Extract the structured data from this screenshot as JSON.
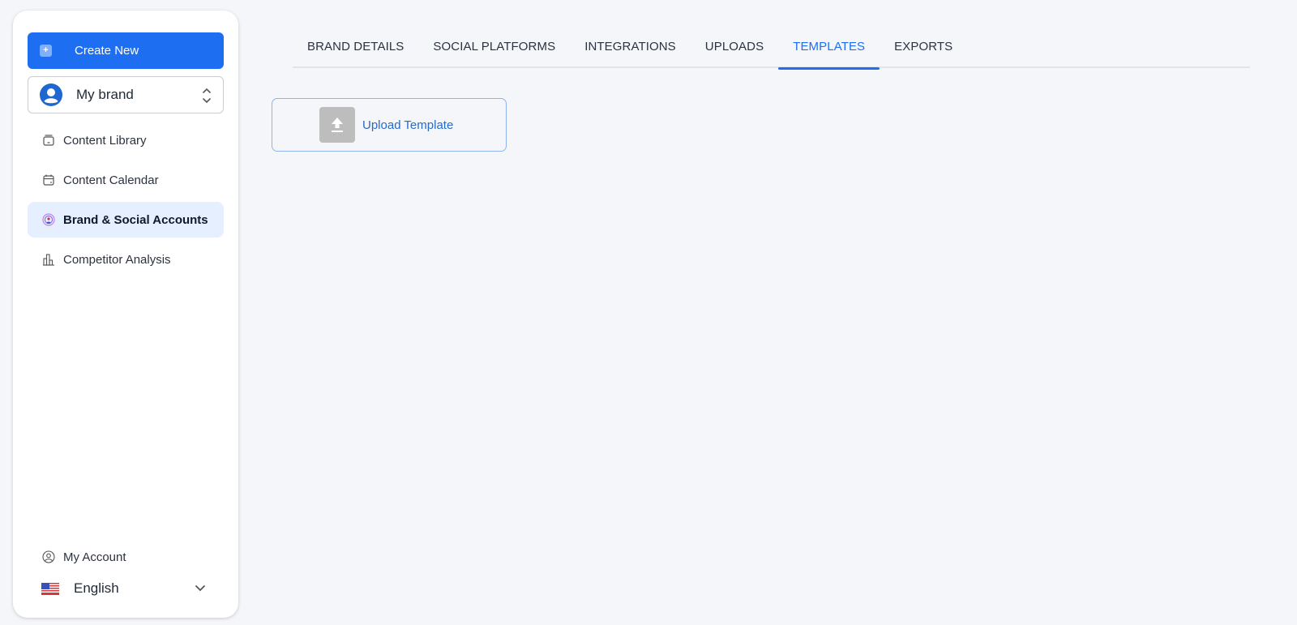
{
  "sidebar": {
    "create_button": {
      "label": "Create New",
      "icon": "plus-icon"
    },
    "brand_selector": {
      "value": "My brand",
      "icon": "user-circle-icon"
    },
    "nav_items": [
      {
        "label": "Content Library",
        "icon": "archive-box-icon",
        "active": false
      },
      {
        "label": "Content Calendar",
        "icon": "calendar-icon",
        "active": false
      },
      {
        "label": "Brand & Social Accounts",
        "icon": "broadcast-user-icon",
        "active": true
      },
      {
        "label": "Competitor Analysis",
        "icon": "bar-chart-icon",
        "active": false
      }
    ],
    "account": {
      "label": "My Account",
      "icon": "user-circle-outline-icon"
    },
    "language": {
      "value": "English",
      "flag": "us-flag-icon"
    }
  },
  "tabs": [
    {
      "label": "BRAND DETAILS",
      "active": false
    },
    {
      "label": "SOCIAL PLATFORMS",
      "active": false
    },
    {
      "label": "INTEGRATIONS",
      "active": false
    },
    {
      "label": "UPLOADS",
      "active": false
    },
    {
      "label": "TEMPLATES",
      "active": true
    },
    {
      "label": "EXPORTS",
      "active": false
    }
  ],
  "upload_template": {
    "label": "Upload Template",
    "icon": "upload-icon"
  },
  "colors": {
    "accent": "#1e6ef2",
    "active_nav_bg": "#e6efff",
    "page_bg": "#f4f6f9"
  }
}
